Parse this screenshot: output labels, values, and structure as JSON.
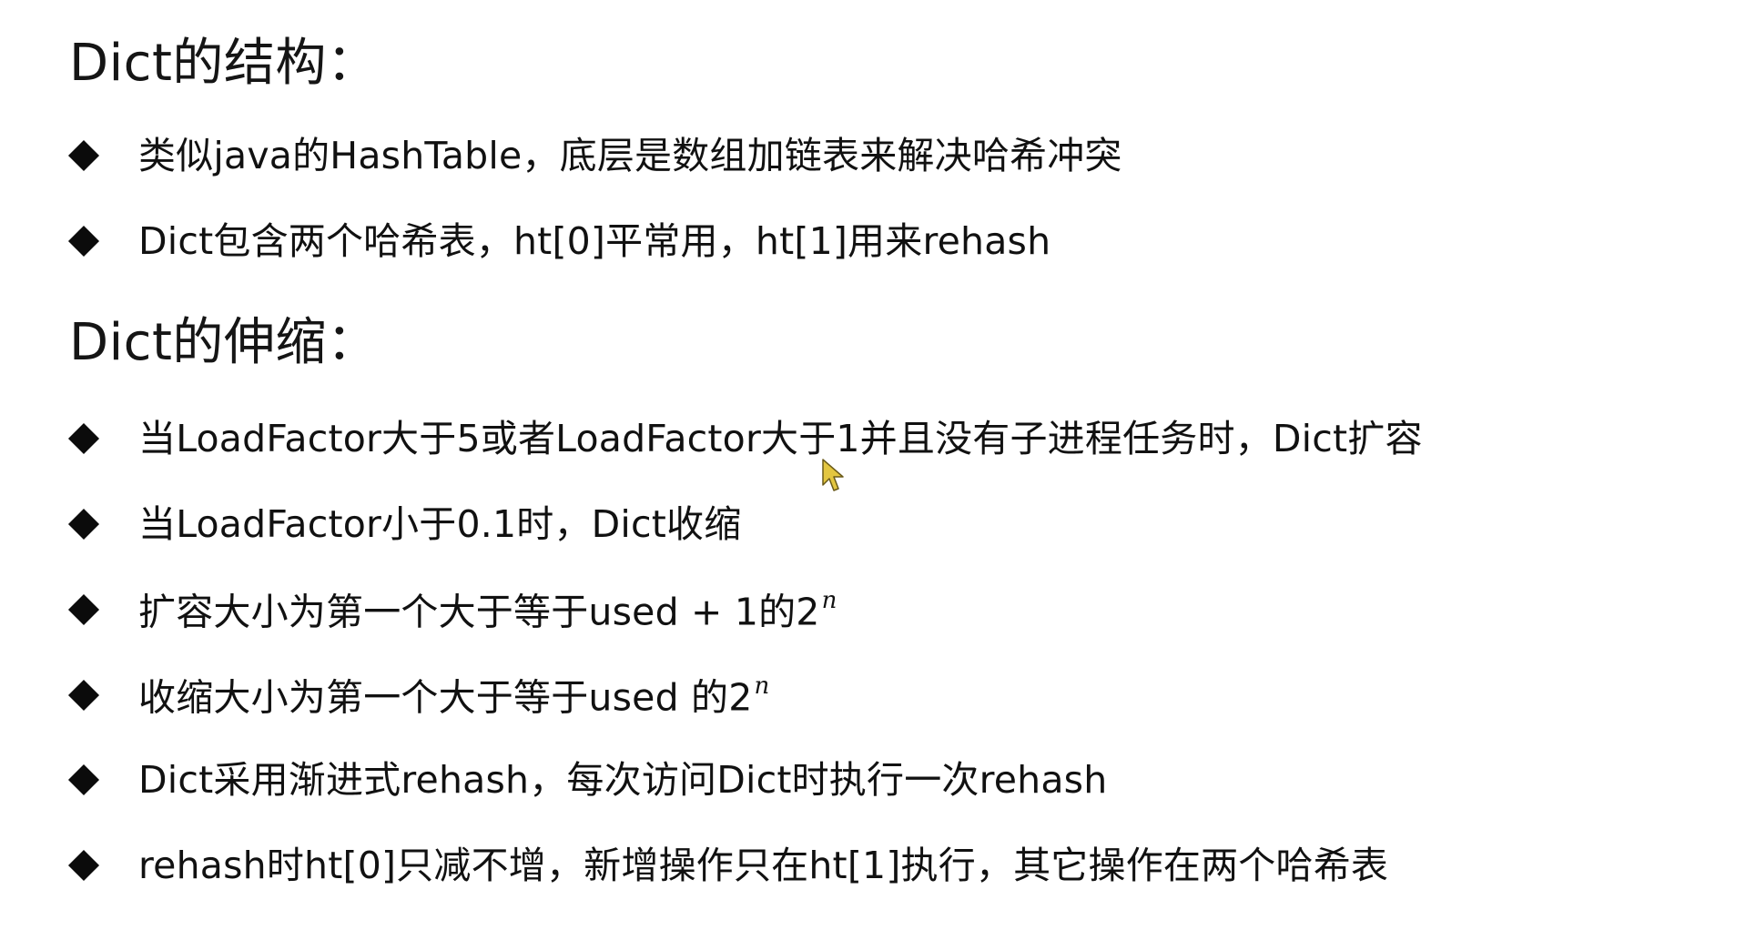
{
  "sections": [
    {
      "title": "Dict的结构：",
      "items": [
        "类似java的HashTable，底层是数组加链表来解决哈希冲突",
        "Dict包含两个哈希表，ht[0]平常用，ht[1]用来rehash"
      ]
    },
    {
      "title": "Dict的伸缩：",
      "items": [
        "当LoadFactor大于5或者LoadFactor大于1并且没有子进程任务时，Dict扩容",
        "当LoadFactor小于0.1时，Dict收缩",
        {
          "text": "扩容大小为第一个大于等于used + 1的2",
          "superscript": "n"
        },
        {
          "text": "收缩大小为第一个大于等于used 的2",
          "superscript": "n"
        },
        "Dict采用渐进式rehash，每次访问Dict时执行一次rehash",
        "rehash时ht[0]只减不增，新增操作只在ht[1]执行，其它操作在两个哈希表"
      ]
    }
  ],
  "icons": {
    "bullet": "diamond-bullet-icon",
    "pointer": "mouse-cursor-icon"
  },
  "colors": {
    "background": "#ffffff",
    "text": "#111111",
    "bullet": "#0b0b0b",
    "cursor_fill": "#e3c640",
    "cursor_stroke": "#6a5a18"
  }
}
